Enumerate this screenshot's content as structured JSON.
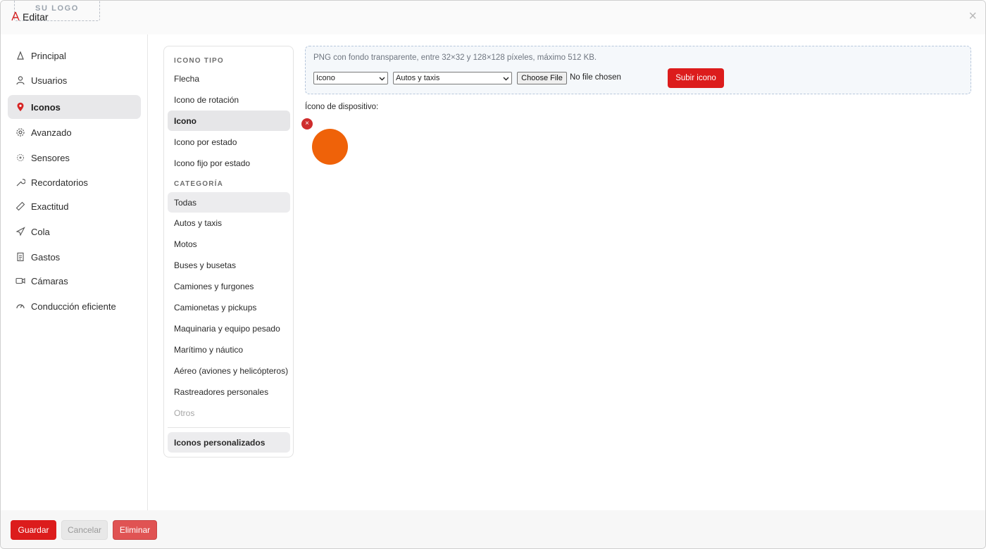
{
  "header": {
    "logo_text": "SU LOGO",
    "title": "Editar",
    "close_glyph": "×"
  },
  "sidebar": {
    "items": [
      {
        "label": "Principal",
        "icon": "principal-icon"
      },
      {
        "label": "Usuarios",
        "icon": "user-icon"
      },
      {
        "label": "Iconos",
        "icon": "map-pin-icon",
        "active": true
      },
      {
        "label": "Avanzado",
        "icon": "gear-icon"
      },
      {
        "label": "Sensores",
        "icon": "sensor-icon"
      },
      {
        "label": "Recordatorios",
        "icon": "wrench-icon"
      },
      {
        "label": "Exactitud",
        "icon": "ruler-icon"
      },
      {
        "label": "Cola",
        "icon": "send-icon"
      },
      {
        "label": "Gastos",
        "icon": "receipt-icon"
      },
      {
        "label": "Cámaras",
        "icon": "camera-icon"
      },
      {
        "label": "Conducción eficiente",
        "icon": "gauge-icon"
      }
    ]
  },
  "categories": {
    "tipo_title": "ICONO TIPO",
    "tipo_items": [
      "Flecha",
      "Icono de rotación",
      "Icono",
      "Icono por estado",
      "Icono fijo por estado"
    ],
    "tipo_selected": "Icono",
    "categoria_title": "CATEGORÍA",
    "categoria_items": [
      "Todas",
      "Autos y taxis",
      "Motos",
      "Buses y busetas",
      "Camiones y furgones",
      "Camionetas y pickups",
      "Maquinaria y equipo pesado",
      "Marítimo y náutico",
      "Aéreo (aviones y helicópteros)",
      "Rastreadores personales",
      "Otros"
    ],
    "custom_label": "Iconos personalizados"
  },
  "upload": {
    "hint": "PNG con fondo transparente, entre 32×32 y 128×128 píxeles, máximo 512 KB.",
    "type_select": "Icono",
    "category_select": "Autos y taxis",
    "file_button": "Choose File",
    "file_status": "No file chosen",
    "submit_label": "Subir icono"
  },
  "device_icon": {
    "label": "Ícono de dispositivo:",
    "remove_glyph": "×",
    "color": "#ef6209"
  },
  "footer": {
    "save": "Guardar",
    "cancel": "Cancelar",
    "delete": "Eliminar"
  },
  "colors": {
    "accent": "#dc1c1c",
    "active_bg": "#e8e8ea"
  }
}
